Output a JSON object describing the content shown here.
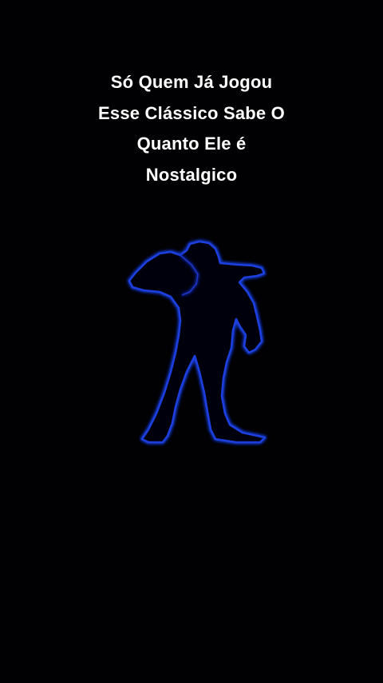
{
  "caption": {
    "lines": [
      "Só Quem Já Jogou",
      "Esse Clássico Sabe O",
      "Quanto Ele é",
      "Nostalgico"
    ]
  },
  "figure": {
    "icon": "glowing-fighter-silhouette-icon",
    "outline_color": "#1f3fe0",
    "glow_color": "#2b5cff"
  },
  "colors": {
    "background": "#010103",
    "text": "#ffffff"
  }
}
